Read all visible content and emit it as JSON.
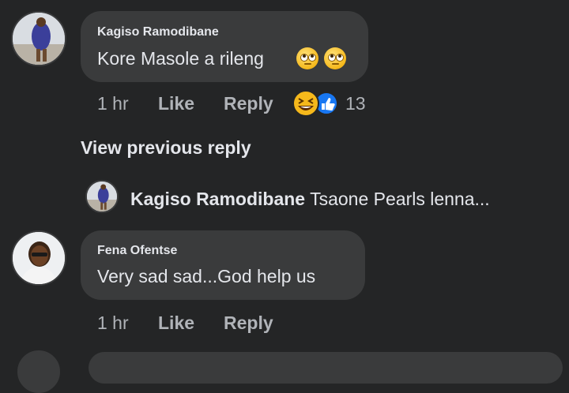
{
  "comments": [
    {
      "author": "Kagiso Ramodibane",
      "text": "Kore Masole a rileng",
      "emojis": [
        "face-with-rolling-eyes-icon",
        "face-with-rolling-eyes-icon"
      ],
      "time": "1 hr",
      "like_label": "Like",
      "reply_label": "Reply",
      "reaction_count": "13",
      "reactions": [
        "laughing-reaction-icon",
        "like-reaction-icon"
      ]
    },
    {
      "author": "Fena Ofentse",
      "text": "Very sad sad...God help us",
      "time": "1 hr",
      "like_label": "Like",
      "reply_label": "Reply"
    }
  ],
  "view_previous_reply": "View previous reply",
  "reply_preview": {
    "author": "Kagiso Ramodibane",
    "text": "Tsaone Pearls lenna..."
  },
  "colors": {
    "background": "#242526",
    "bubble": "#3a3b3c",
    "primary_text": "#e4e6eb",
    "secondary_text": "#b0b3b8",
    "like_blue": "#1877f2",
    "emoji_yellow": "#f5b81b"
  }
}
